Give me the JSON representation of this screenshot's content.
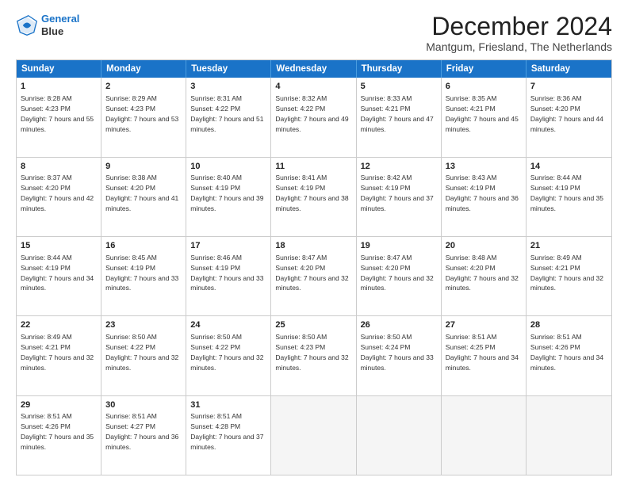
{
  "logo": {
    "line1": "General",
    "line2": "Blue"
  },
  "title": "December 2024",
  "subtitle": "Mantgum, Friesland, The Netherlands",
  "header_days": [
    "Sunday",
    "Monday",
    "Tuesday",
    "Wednesday",
    "Thursday",
    "Friday",
    "Saturday"
  ],
  "weeks": [
    [
      {
        "day": "1",
        "rise": "Sunrise: 8:28 AM",
        "set": "Sunset: 4:23 PM",
        "daylight": "Daylight: 7 hours and 55 minutes."
      },
      {
        "day": "2",
        "rise": "Sunrise: 8:29 AM",
        "set": "Sunset: 4:23 PM",
        "daylight": "Daylight: 7 hours and 53 minutes."
      },
      {
        "day": "3",
        "rise": "Sunrise: 8:31 AM",
        "set": "Sunset: 4:22 PM",
        "daylight": "Daylight: 7 hours and 51 minutes."
      },
      {
        "day": "4",
        "rise": "Sunrise: 8:32 AM",
        "set": "Sunset: 4:22 PM",
        "daylight": "Daylight: 7 hours and 49 minutes."
      },
      {
        "day": "5",
        "rise": "Sunrise: 8:33 AM",
        "set": "Sunset: 4:21 PM",
        "daylight": "Daylight: 7 hours and 47 minutes."
      },
      {
        "day": "6",
        "rise": "Sunrise: 8:35 AM",
        "set": "Sunset: 4:21 PM",
        "daylight": "Daylight: 7 hours and 45 minutes."
      },
      {
        "day": "7",
        "rise": "Sunrise: 8:36 AM",
        "set": "Sunset: 4:20 PM",
        "daylight": "Daylight: 7 hours and 44 minutes."
      }
    ],
    [
      {
        "day": "8",
        "rise": "Sunrise: 8:37 AM",
        "set": "Sunset: 4:20 PM",
        "daylight": "Daylight: 7 hours and 42 minutes."
      },
      {
        "day": "9",
        "rise": "Sunrise: 8:38 AM",
        "set": "Sunset: 4:20 PM",
        "daylight": "Daylight: 7 hours and 41 minutes."
      },
      {
        "day": "10",
        "rise": "Sunrise: 8:40 AM",
        "set": "Sunset: 4:19 PM",
        "daylight": "Daylight: 7 hours and 39 minutes."
      },
      {
        "day": "11",
        "rise": "Sunrise: 8:41 AM",
        "set": "Sunset: 4:19 PM",
        "daylight": "Daylight: 7 hours and 38 minutes."
      },
      {
        "day": "12",
        "rise": "Sunrise: 8:42 AM",
        "set": "Sunset: 4:19 PM",
        "daylight": "Daylight: 7 hours and 37 minutes."
      },
      {
        "day": "13",
        "rise": "Sunrise: 8:43 AM",
        "set": "Sunset: 4:19 PM",
        "daylight": "Daylight: 7 hours and 36 minutes."
      },
      {
        "day": "14",
        "rise": "Sunrise: 8:44 AM",
        "set": "Sunset: 4:19 PM",
        "daylight": "Daylight: 7 hours and 35 minutes."
      }
    ],
    [
      {
        "day": "15",
        "rise": "Sunrise: 8:44 AM",
        "set": "Sunset: 4:19 PM",
        "daylight": "Daylight: 7 hours and 34 minutes."
      },
      {
        "day": "16",
        "rise": "Sunrise: 8:45 AM",
        "set": "Sunset: 4:19 PM",
        "daylight": "Daylight: 7 hours and 33 minutes."
      },
      {
        "day": "17",
        "rise": "Sunrise: 8:46 AM",
        "set": "Sunset: 4:19 PM",
        "daylight": "Daylight: 7 hours and 33 minutes."
      },
      {
        "day": "18",
        "rise": "Sunrise: 8:47 AM",
        "set": "Sunset: 4:20 PM",
        "daylight": "Daylight: 7 hours and 32 minutes."
      },
      {
        "day": "19",
        "rise": "Sunrise: 8:47 AM",
        "set": "Sunset: 4:20 PM",
        "daylight": "Daylight: 7 hours and 32 minutes."
      },
      {
        "day": "20",
        "rise": "Sunrise: 8:48 AM",
        "set": "Sunset: 4:20 PM",
        "daylight": "Daylight: 7 hours and 32 minutes."
      },
      {
        "day": "21",
        "rise": "Sunrise: 8:49 AM",
        "set": "Sunset: 4:21 PM",
        "daylight": "Daylight: 7 hours and 32 minutes."
      }
    ],
    [
      {
        "day": "22",
        "rise": "Sunrise: 8:49 AM",
        "set": "Sunset: 4:21 PM",
        "daylight": "Daylight: 7 hours and 32 minutes."
      },
      {
        "day": "23",
        "rise": "Sunrise: 8:50 AM",
        "set": "Sunset: 4:22 PM",
        "daylight": "Daylight: 7 hours and 32 minutes."
      },
      {
        "day": "24",
        "rise": "Sunrise: 8:50 AM",
        "set": "Sunset: 4:22 PM",
        "daylight": "Daylight: 7 hours and 32 minutes."
      },
      {
        "day": "25",
        "rise": "Sunrise: 8:50 AM",
        "set": "Sunset: 4:23 PM",
        "daylight": "Daylight: 7 hours and 32 minutes."
      },
      {
        "day": "26",
        "rise": "Sunrise: 8:50 AM",
        "set": "Sunset: 4:24 PM",
        "daylight": "Daylight: 7 hours and 33 minutes."
      },
      {
        "day": "27",
        "rise": "Sunrise: 8:51 AM",
        "set": "Sunset: 4:25 PM",
        "daylight": "Daylight: 7 hours and 34 minutes."
      },
      {
        "day": "28",
        "rise": "Sunrise: 8:51 AM",
        "set": "Sunset: 4:26 PM",
        "daylight": "Daylight: 7 hours and 34 minutes."
      }
    ],
    [
      {
        "day": "29",
        "rise": "Sunrise: 8:51 AM",
        "set": "Sunset: 4:26 PM",
        "daylight": "Daylight: 7 hours and 35 minutes."
      },
      {
        "day": "30",
        "rise": "Sunrise: 8:51 AM",
        "set": "Sunset: 4:27 PM",
        "daylight": "Daylight: 7 hours and 36 minutes."
      },
      {
        "day": "31",
        "rise": "Sunrise: 8:51 AM",
        "set": "Sunset: 4:28 PM",
        "daylight": "Daylight: 7 hours and 37 minutes."
      },
      {
        "day": "",
        "rise": "",
        "set": "",
        "daylight": ""
      },
      {
        "day": "",
        "rise": "",
        "set": "",
        "daylight": ""
      },
      {
        "day": "",
        "rise": "",
        "set": "",
        "daylight": ""
      },
      {
        "day": "",
        "rise": "",
        "set": "",
        "daylight": ""
      }
    ]
  ]
}
